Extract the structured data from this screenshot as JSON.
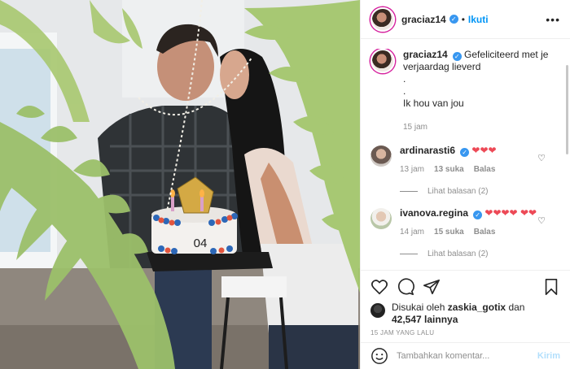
{
  "post": {
    "username": "graciaz14",
    "follow_label": "Ikuti",
    "dot": "•",
    "more_icon": "more-options-icon"
  },
  "photo": {
    "description_icon": "post-photo",
    "cake_text": "04"
  },
  "caption": {
    "username": "graciaz14",
    "line1": "Gefeliciteerd met je verjaardag lieverd",
    "line2": ".",
    "line3": ".",
    "line4": "Ik hou van jou",
    "time": "15 jam"
  },
  "comments": [
    {
      "username": "ardinarasti6",
      "text": "❤❤❤",
      "time": "13 jam",
      "likes": "13 suka",
      "reply_label": "Balas",
      "view_replies": "Lihat balasan (2)"
    },
    {
      "username": "ivanova.regina",
      "text": "❤❤❤❤ ❤❤",
      "time": "14 jam",
      "likes": "15 suka",
      "reply_label": "Balas",
      "view_replies": "Lihat balasan (2)"
    }
  ],
  "likes": {
    "prefix": "Disukai oleh",
    "user": "zaskia_gotix",
    "middle": "dan",
    "count": "42,547 lainnya"
  },
  "date": "15 JAM YANG LALU",
  "add_comment": {
    "placeholder": "Tambahkan komentar...",
    "send_label": "Kirim"
  },
  "colors": {
    "accent": "#0095f6",
    "heart": "#ed4956",
    "verified": "#3897f0"
  }
}
